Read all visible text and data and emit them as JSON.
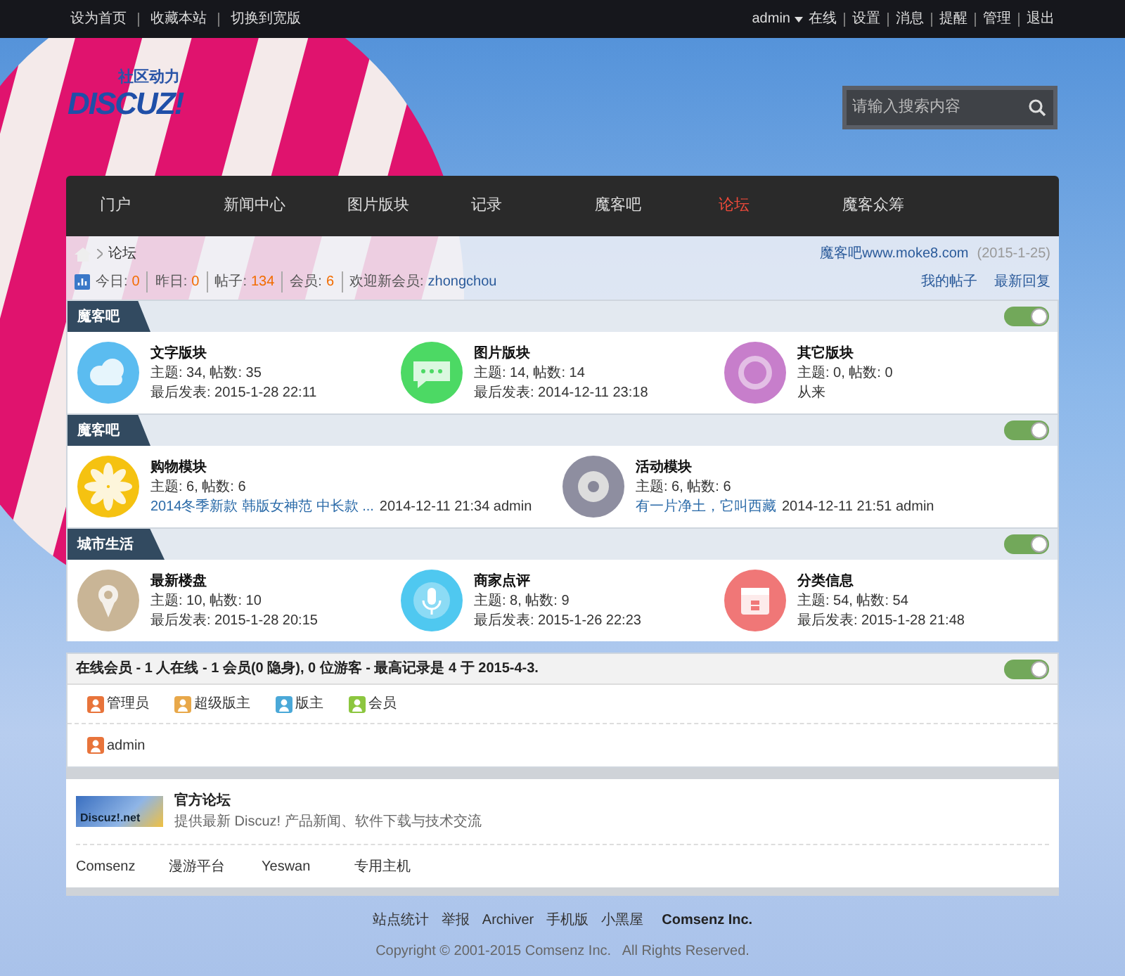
{
  "top_bar": {
    "left_links": [
      "设为首页",
      "收藏本站",
      "切换到宽版"
    ],
    "user": "admin",
    "right_links": [
      "在线",
      "设置",
      "消息",
      "提醒",
      "管理",
      "退出"
    ]
  },
  "logo": {
    "tagline": "社区动力",
    "wordmark": "DISCUZ!"
  },
  "search": {
    "placeholder": "请输入搜索内容"
  },
  "nav": [
    {
      "label": "门户",
      "selected": false
    },
    {
      "label": "新闻中心",
      "selected": false
    },
    {
      "label": "图片版块",
      "selected": false
    },
    {
      "label": "记录",
      "selected": false
    },
    {
      "label": "魔客吧",
      "selected": false
    },
    {
      "label": "论坛",
      "selected": true
    },
    {
      "label": "魔客众筹",
      "selected": false
    }
  ],
  "breadcrumb": {
    "current": "论坛",
    "site_link": "魔客吧www.moke8.com",
    "date": "(2015-1-25)"
  },
  "stats": [
    {
      "label": "今日:",
      "value": "0"
    },
    {
      "label": "昨日:",
      "value": "0"
    },
    {
      "label": "帖子:",
      "value": "134"
    },
    {
      "label": "会员:",
      "value": "6"
    }
  ],
  "welcome": {
    "label": "欢迎新会员:",
    "member": "zhongchou"
  },
  "quick_links": [
    "我的帖子",
    "最新回复"
  ],
  "categories": [
    {
      "title": "魔客吧",
      "expanded": true,
      "forums": [
        {
          "name": "文字版块",
          "kind": "cloud",
          "color": "#5bbcf0",
          "stats": "主题: 34, 帖数: 35",
          "last": "最后发表: 2015-1-28 22:11"
        },
        {
          "name": "图片版块",
          "kind": "chat",
          "color": "#4cd964",
          "stats": "主题: 14, 帖数: 14",
          "last": "最后发表: 2014-12-11 23:18"
        },
        {
          "name": "其它版块",
          "kind": "ring",
          "color": "#c77ecb",
          "stats": "主题: 0, 帖数: 0",
          "last": "从来"
        }
      ]
    },
    {
      "title": "魔客吧",
      "expanded": true,
      "forums": [
        {
          "name": "购物模块",
          "kind": "flower",
          "color": "#f5c211",
          "stats": "主题: 6, 帖数: 6",
          "last_link": "2014冬季新款 韩版女神范 中长款 ...",
          "last": "2014-12-11 21:34 admin"
        },
        {
          "name": "活动模块",
          "kind": "gear",
          "color": "#8e8ea0",
          "stats": "主题: 6, 帖数: 6",
          "last_link": "有一片净土，它叫西藏",
          "last": "2014-12-11 21:51 admin"
        }
      ]
    },
    {
      "title": "城市生活",
      "expanded": true,
      "forums": [
        {
          "name": "最新楼盘",
          "kind": "pin",
          "color": "#c9b596",
          "stats": "主题: 10, 帖数: 10",
          "last": "最后发表: 2015-1-28 20:15"
        },
        {
          "name": "商家点评",
          "kind": "mic",
          "color": "#4fc8f0",
          "stats": "主题: 8, 帖数: 9",
          "last": "最后发表: 2015-1-26 22:23"
        },
        {
          "name": "分类信息",
          "kind": "calendar",
          "color": "#f07777",
          "stats": "主题: 54, 帖数: 54",
          "last": "最后发表: 2015-1-28 21:48"
        }
      ]
    }
  ],
  "online": {
    "title": "在线会员 - 1 人在线 - 1 会员(0 隐身), 0 位游客 - 最高记录是 4 于 2015-4-3.",
    "expanded": true,
    "legend": [
      {
        "label": "管理员",
        "color": "#e8743b"
      },
      {
        "label": "超级版主",
        "color": "#e8a84a"
      },
      {
        "label": "版主",
        "color": "#4aa8d8"
      },
      {
        "label": "会员",
        "color": "#8cc63f"
      }
    ],
    "members": [
      {
        "name": "admin",
        "color": "#e8743b"
      }
    ]
  },
  "links": {
    "official": {
      "logo_text": "Discuz!.net",
      "name": "官方论坛",
      "description": "提供最新 Discuz! 产品新闻、软件下载与技术交流"
    },
    "items": [
      "Comsenz",
      "漫游平台",
      "Yeswan",
      "专用主机"
    ]
  },
  "footer": {
    "links": [
      "站点统计",
      "举报",
      "Archiver",
      "手机版",
      "小黑屋"
    ],
    "brand": "Comsenz Inc.",
    "copyright": "Copyright © 2001-2015 Comsenz Inc.   All Rights Reserved."
  }
}
